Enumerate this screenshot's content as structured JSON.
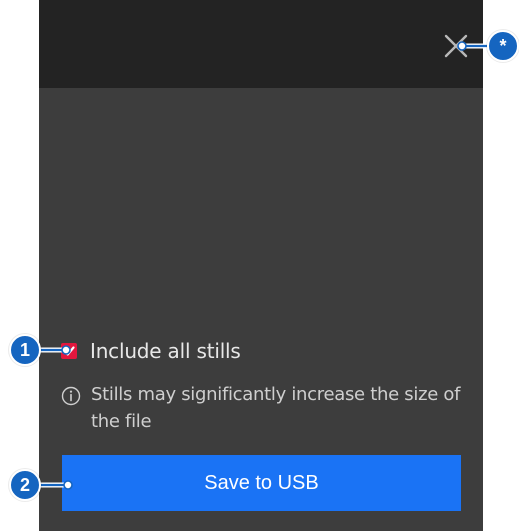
{
  "dialog": {
    "close_icon": "close-icon",
    "include_stills": {
      "label": "Include all stills",
      "checked": true,
      "check_color": "#e3173e"
    },
    "info": {
      "icon": "info-icon",
      "text": "Stills may significantly increase the size of the file"
    },
    "save_button": {
      "label": "Save to USB",
      "color": "#1a73f5"
    },
    "colors": {
      "header": "#232323",
      "body": "#3d3d3d"
    }
  },
  "callouts": {
    "close": "*",
    "checkbox": "1",
    "save": "2",
    "color": "#1565c0"
  }
}
